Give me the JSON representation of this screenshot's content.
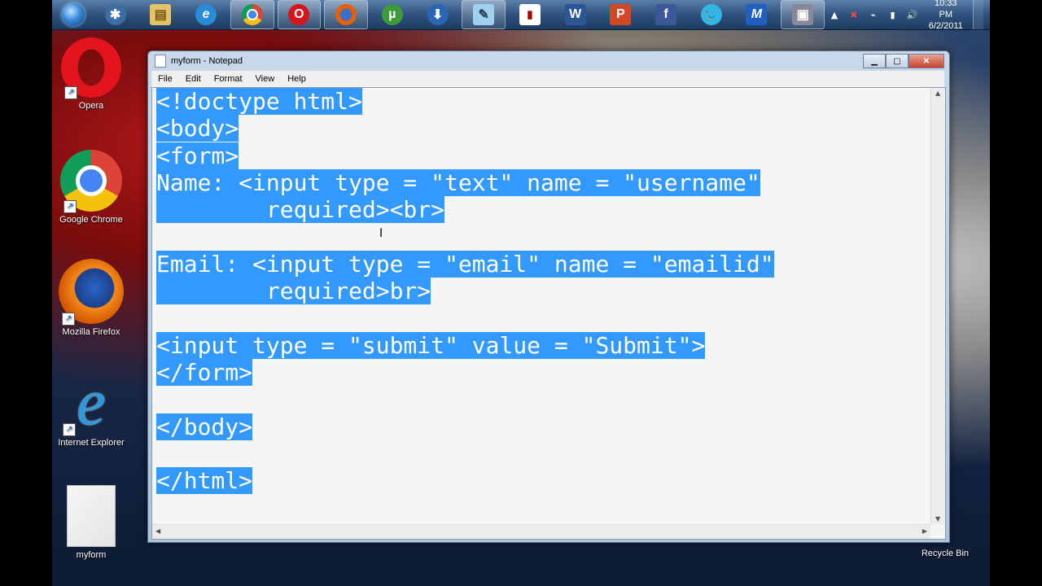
{
  "taskbar": {
    "clock_time": "10:33 PM",
    "clock_date": "6/2/2011",
    "pinned": [
      {
        "name": "start-orb-button"
      },
      {
        "name": "network-app-button"
      },
      {
        "name": "file-explorer-button"
      },
      {
        "name": "internet-explorer-button"
      },
      {
        "name": "chrome-button"
      },
      {
        "name": "opera-button"
      },
      {
        "name": "firefox-button"
      },
      {
        "name": "utorrent-button"
      },
      {
        "name": "download-manager-button"
      },
      {
        "name": "notepad-button"
      },
      {
        "name": "app-button"
      },
      {
        "name": "word-button"
      },
      {
        "name": "powerpoint-button"
      },
      {
        "name": "facebook-button"
      },
      {
        "name": "twitter-button"
      },
      {
        "name": "m-app-button"
      },
      {
        "name": "media-app-button"
      }
    ]
  },
  "desktop": {
    "icons": [
      {
        "label": "Opera"
      },
      {
        "label": "Google Chrome"
      },
      {
        "label": "Mozilla Firefox"
      },
      {
        "label": "Internet Explorer"
      },
      {
        "label": "myform"
      },
      {
        "label": "Recycle Bin"
      }
    ]
  },
  "window": {
    "title": "myform - Notepad",
    "menu": [
      "File",
      "Edit",
      "Format",
      "View",
      "Help"
    ],
    "lines": [
      "<!doctype html>",
      "<body>",
      "<form>",
      "Name: <input type = \"text\" name = \"username\"",
      "        required><br>",
      "",
      "Email: <input type = \"email\" name = \"emailid\"",
      "        required>br>",
      "",
      "<input type = \"submit\" value = \"Submit\">",
      "</form>",
      "",
      "</body>",
      "",
      "</html>"
    ]
  }
}
